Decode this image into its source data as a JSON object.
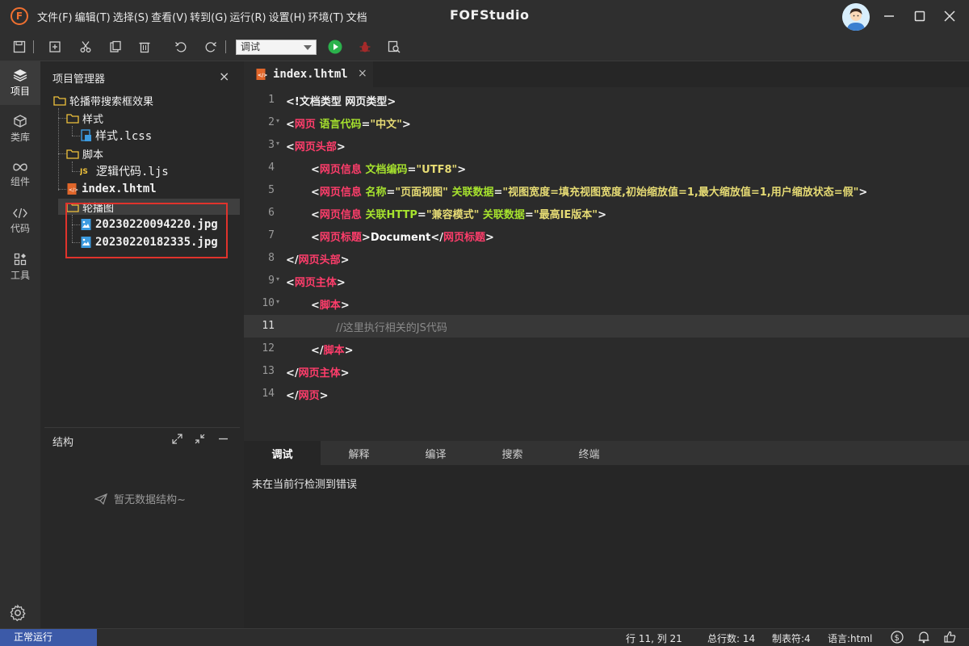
{
  "app": {
    "logo_letter": "F",
    "title": "FOFStudio",
    "menu": [
      "文件(F)",
      "编辑(T)",
      "选择(S)",
      "查看(V)",
      "转到(G)",
      "运行(R)",
      "设置(H)",
      "环境(T)",
      "文档"
    ]
  },
  "toolbar": {
    "mode_value": "调试"
  },
  "activity": [
    {
      "label": "项目",
      "icon": "layers-icon"
    },
    {
      "label": "类库",
      "icon": "cube-icon"
    },
    {
      "label": "组件",
      "icon": "infinity-icon"
    },
    {
      "label": "代码",
      "icon": "code-icon"
    },
    {
      "label": "工具",
      "icon": "tools-icon"
    }
  ],
  "project": {
    "header": "项目管理器",
    "close": "×",
    "root": "轮播带搜索框效果",
    "folder_style": "样式",
    "file_style": "样式.lcss",
    "folder_script": "脚本",
    "file_script": "逻辑代码.ljs",
    "file_index": "index.lhtml",
    "folder_carousel": "轮播图",
    "image1": "20230220094220.jpg",
    "image2": "20230220182335.jpg"
  },
  "structure": {
    "header": "结构",
    "empty": "暂无数据结构~"
  },
  "editor": {
    "tab_name": "index.lhtml",
    "tab_close": "×",
    "lines": [
      {
        "n": "1",
        "parts": [
          [
            "p",
            "<!文档类型 网页类型>"
          ]
        ]
      },
      {
        "n": "2",
        "parts": [
          [
            "p",
            "<"
          ],
          [
            "t",
            "网页"
          ],
          [
            "p",
            " "
          ],
          [
            "a",
            "语言代码"
          ],
          [
            "p",
            "="
          ],
          [
            "s",
            "\"中文\""
          ],
          [
            "p",
            ">"
          ]
        ]
      },
      {
        "n": "3",
        "parts": [
          [
            "p",
            "<"
          ],
          [
            "t",
            "网页头部"
          ],
          [
            "p",
            ">"
          ]
        ]
      },
      {
        "n": "4",
        "parts": [
          [
            "p",
            "<"
          ],
          [
            "t",
            "网页信息"
          ],
          [
            "p",
            " "
          ],
          [
            "a",
            "文档编码"
          ],
          [
            "p",
            "="
          ],
          [
            "s",
            "\"UTF8\""
          ],
          [
            "p",
            ">"
          ]
        ]
      },
      {
        "n": "5",
        "parts": [
          [
            "p",
            "<"
          ],
          [
            "t",
            "网页信息"
          ],
          [
            "p",
            " "
          ],
          [
            "a",
            "名称"
          ],
          [
            "p",
            "="
          ],
          [
            "s",
            "\"页面视图\""
          ],
          [
            "p",
            " "
          ],
          [
            "a",
            "关联数据"
          ],
          [
            "p",
            "="
          ],
          [
            "s",
            "\"视图宽度=填充视图宽度,初始缩放值=1,最大缩放值=1,用户缩放状态=假\""
          ],
          [
            "p",
            ">"
          ]
        ]
      },
      {
        "n": "6",
        "parts": [
          [
            "p",
            "<"
          ],
          [
            "t",
            "网页信息"
          ],
          [
            "p",
            " "
          ],
          [
            "a",
            "关联HTTP"
          ],
          [
            "p",
            "="
          ],
          [
            "s",
            "\"兼容模式\""
          ],
          [
            "p",
            " "
          ],
          [
            "a",
            "关联数据"
          ],
          [
            "p",
            "="
          ],
          [
            "s",
            "\"最高IE版本\""
          ],
          [
            "p",
            ">"
          ]
        ]
      },
      {
        "n": "7",
        "parts": [
          [
            "p",
            "<"
          ],
          [
            "t",
            "网页标题"
          ],
          [
            "p",
            ">"
          ],
          [
            "w",
            "Document"
          ],
          [
            "p",
            "</"
          ],
          [
            "t",
            "网页标题"
          ],
          [
            "p",
            ">"
          ]
        ]
      },
      {
        "n": "8",
        "parts": [
          [
            "p",
            "</"
          ],
          [
            "t",
            "网页头部"
          ],
          [
            "p",
            ">"
          ]
        ]
      },
      {
        "n": "9",
        "parts": [
          [
            "p",
            "<"
          ],
          [
            "t",
            "网页主体"
          ],
          [
            "p",
            ">"
          ]
        ]
      },
      {
        "n": "10",
        "parts": [
          [
            "p",
            "<"
          ],
          [
            "t",
            "脚本"
          ],
          [
            "p",
            ">"
          ]
        ]
      },
      {
        "n": "11",
        "parts": [
          [
            "c",
            "//这里执行相关的JS代码"
          ]
        ]
      },
      {
        "n": "12",
        "parts": [
          [
            "p",
            "</"
          ],
          [
            "t",
            "脚本"
          ],
          [
            "p",
            ">"
          ]
        ]
      },
      {
        "n": "13",
        "parts": [
          [
            "p",
            "</"
          ],
          [
            "t",
            "网页主体"
          ],
          [
            "p",
            ">"
          ]
        ]
      },
      {
        "n": "14",
        "parts": [
          [
            "p",
            "</"
          ],
          [
            "t",
            "网页"
          ],
          [
            "p",
            ">"
          ]
        ]
      }
    ]
  },
  "bottom": {
    "tabs": [
      "调试",
      "解释",
      "编译",
      "搜索",
      "终端"
    ],
    "message": "未在当前行检测到错误"
  },
  "status": {
    "state": "正常运行",
    "position": "行 11, 列 21",
    "total_lines": "总行数: 14",
    "tab_size": "制表符:4",
    "language": "语言:html"
  },
  "colors": {
    "tag": "#ff3d6b",
    "attr": "#a6e22e",
    "string": "#e6db74",
    "status_accent": "#3c5aa8",
    "highlight_box": "#e0332c"
  }
}
